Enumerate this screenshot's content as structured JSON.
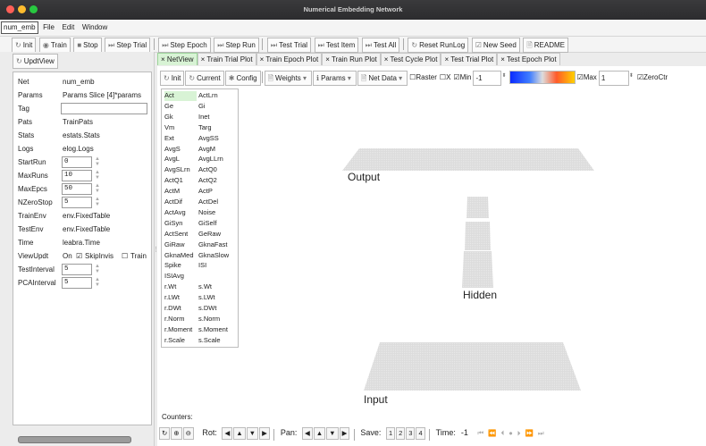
{
  "window": {
    "title": "Numerical Embedding Network"
  },
  "menubar": {
    "app": "num_emb",
    "file": "File",
    "edit": "Edit",
    "window": "Window"
  },
  "toolbar": {
    "items": [
      "Init",
      "Train",
      "Stop",
      "Step Trial",
      "Step Epoch",
      "Step Run",
      "Test Trial",
      "Test Item",
      "Test All",
      "Reset RunLog",
      "New Seed",
      "README"
    ]
  },
  "left": {
    "updt": "UpdtView",
    "rows": [
      {
        "k": "Net",
        "v": "num_emb"
      },
      {
        "k": "Params",
        "v": "Params  Slice [4]*params"
      },
      {
        "k": "Tag",
        "v": ""
      },
      {
        "k": "Pats",
        "v": "TrainPats"
      },
      {
        "k": "Stats",
        "v": "estats.Stats"
      },
      {
        "k": "Logs",
        "v": "elog.Logs"
      },
      {
        "k": "StartRun",
        "v": "0"
      },
      {
        "k": "MaxRuns",
        "v": "10"
      },
      {
        "k": "MaxEpcs",
        "v": "50"
      },
      {
        "k": "NZeroStop",
        "v": "5"
      },
      {
        "k": "TrainEnv",
        "v": "env.FixedTable"
      },
      {
        "k": "TestEnv",
        "v": "env.FixedTable"
      },
      {
        "k": "Time",
        "v": "leabra.Time"
      },
      {
        "k": "ViewUpdt",
        "v": "On"
      },
      {
        "k": "TestInterval",
        "v": "5"
      },
      {
        "k": "PCAInterval",
        "v": "5"
      }
    ],
    "viewupdt": {
      "skip": "SkipInvis",
      "train": "Train",
      "skip_checked": true,
      "train_checked": false
    }
  },
  "tabs": [
    "NetView",
    "Train Trial Plot",
    "Train Epoch Plot",
    "Train Run Plot",
    "Test Cycle Plot",
    "Test Trial Plot",
    "Test Epoch Plot"
  ],
  "netbar": {
    "init": "Init",
    "current": "Current",
    "config": "Config",
    "weights": "Weights",
    "params": "Params",
    "netdata": "Net Data",
    "raster": "Raster",
    "x": "X",
    "min": "Min",
    "min_val": "-1",
    "max": "Max",
    "max_val": "1",
    "zeroctr": "ZeroCtr"
  },
  "vars": [
    [
      "Act",
      "ActLrn"
    ],
    [
      "Ge",
      "Gi"
    ],
    [
      "Gk",
      "Inet"
    ],
    [
      "Vm",
      "Targ"
    ],
    [
      "Ext",
      "AvgSS"
    ],
    [
      "AvgS",
      "AvgM"
    ],
    [
      "AvgL",
      "AvgLLrn"
    ],
    [
      "AvgSLrn",
      "ActQ0"
    ],
    [
      "ActQ1",
      "ActQ2"
    ],
    [
      "ActM",
      "ActP"
    ],
    [
      "ActDif",
      "ActDel"
    ],
    [
      "ActAvg",
      "Noise"
    ],
    [
      "GiSyn",
      "GiSelf"
    ],
    [
      "ActSent",
      "GeRaw"
    ],
    [
      "GiRaw",
      "GknaFast"
    ],
    [
      "GknaMed",
      "GknaSlow"
    ],
    [
      "Spike",
      "ISI"
    ],
    [
      "ISIAvg",
      ""
    ],
    [
      "r.Wt",
      "s.Wt"
    ],
    [
      "r.LWt",
      "s.LWt"
    ],
    [
      "r.DWt",
      "s.DWt"
    ],
    [
      "r.Norm",
      "s.Norm"
    ],
    [
      "r.Moment",
      "s.Moment"
    ],
    [
      "r.Scale",
      "s.Scale"
    ]
  ],
  "layers": {
    "output": "Output",
    "hidden": "Hidden",
    "input": "Input"
  },
  "counters": "Counters:",
  "bottom": {
    "rot": "Rot:",
    "pan": "Pan:",
    "save": "Save:",
    "saves": [
      "1",
      "2",
      "3",
      "4"
    ],
    "time": "Time:",
    "time_val": "-1"
  },
  "colors": {
    "selected_tab": "#d8f3d5",
    "accent": "#2f9b2f"
  }
}
